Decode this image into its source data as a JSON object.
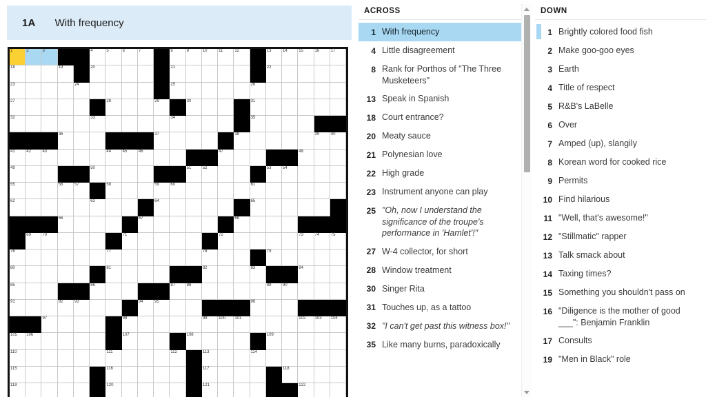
{
  "clue_bar": {
    "number": "1A",
    "text": "With frequency"
  },
  "grid": {
    "size": 21,
    "cursor_cell": {
      "row": 1,
      "col": 1
    },
    "highlight_color": "#a9d9f2",
    "cursor_color": "#fbd033",
    "block_color": "#000000",
    "rows": [
      {
        "blocks": [
          4,
          5,
          10,
          16
        ],
        "nums": {
          "1": "1",
          "2": "2",
          "3": "3",
          "6": "4",
          "7": "5",
          "8": "6",
          "9": "7",
          "11": "8",
          "12": "9",
          "13": "10",
          "14": "11",
          "15": "12",
          "17": "13",
          "18": "14",
          "19": "15",
          "20": "16",
          "21": "17"
        }
      },
      {
        "blocks": [
          5,
          10,
          16
        ],
        "nums": {
          "1": "18",
          "4": "19",
          "6": "20",
          "11": "21",
          "17": "22"
        }
      },
      {
        "blocks": [
          10
        ],
        "nums": {
          "1": "23",
          "5": "24",
          "11": "25",
          "16": "26"
        }
      },
      {
        "blocks": [
          6,
          11,
          15
        ],
        "nums": {
          "1": "27",
          "7": "28",
          "10": "29",
          "12": "30",
          "16": "31"
        }
      },
      {
        "blocks": [
          15,
          20,
          21
        ],
        "nums": {
          "1": "32",
          "6": "33",
          "11": "34",
          "16": "35"
        }
      },
      {
        "blocks": [
          1,
          2,
          3,
          7,
          8,
          9,
          14
        ],
        "nums": {
          "4": "36",
          "10": "37",
          "15": "38",
          "20": "39",
          "21": "40"
        }
      },
      {
        "blocks": [
          12,
          13,
          17,
          18
        ],
        "nums": {
          "1": "41",
          "2": "42",
          "3": "43",
          "7": "44",
          "8": "45",
          "9": "46",
          "14": "47",
          "19": "48"
        }
      },
      {
        "blocks": [
          4,
          5,
          10,
          11,
          16
        ],
        "nums": {
          "1": "49",
          "6": "50",
          "12": "51",
          "13": "52",
          "17": "53",
          "18": "54"
        }
      },
      {
        "blocks": [
          6
        ],
        "nums": {
          "1": "55",
          "4": "56",
          "5": "57",
          "7": "58",
          "10": "59",
          "11": "60",
          "16": "61"
        }
      },
      {
        "blocks": [
          9,
          15,
          21
        ],
        "nums": {
          "1": "62",
          "6": "63",
          "10": "64",
          "16": "65"
        }
      },
      {
        "blocks": [
          1,
          2,
          3,
          8,
          14,
          19,
          20,
          21
        ],
        "nums": {
          "4": "66",
          "9": "67",
          "15": "68"
        }
      },
      {
        "blocks": [
          1,
          7,
          13
        ],
        "nums": {
          "2": "69",
          "3": "70",
          "8": "71",
          "14": "72",
          "19": "73",
          "20": "74",
          "21": "75"
        }
      },
      {
        "blocks": [
          16
        ],
        "nums": {
          "1": "76",
          "7": "77",
          "13": "78",
          "17": "79"
        }
      },
      {
        "blocks": [
          6,
          11,
          12,
          17,
          18
        ],
        "nums": {
          "1": "80",
          "7": "81",
          "13": "82",
          "16": "83",
          "19": "84"
        }
      },
      {
        "blocks": [
          4,
          5,
          9,
          10
        ],
        "nums": {
          "1": "85",
          "6": "86",
          "11": "87",
          "12": "88",
          "17": "89",
          "18": "90"
        }
      },
      {
        "blocks": [
          8,
          13,
          14,
          15,
          19,
          20,
          21
        ],
        "nums": {
          "1": "91",
          "4": "92",
          "5": "93",
          "9": "94",
          "10": "95",
          "16": "96"
        }
      },
      {
        "blocks": [
          1,
          2,
          7
        ],
        "nums": {
          "3": "97",
          "8": "98",
          "13": "99",
          "14": "100",
          "15": "101",
          "19": "102",
          "20": "103",
          "21": "104"
        }
      },
      {
        "blocks": [
          7,
          11,
          16
        ],
        "nums": {
          "1": "105",
          "2": "106",
          "8": "107",
          "12": "108",
          "17": "109"
        }
      },
      {
        "blocks": [
          12
        ],
        "nums": {
          "1": "110",
          "7": "111",
          "11": "112",
          "13": "113",
          "16": "114"
        }
      },
      {
        "blocks": [
          6,
          12,
          17
        ],
        "nums": {
          "1": "115",
          "7": "116",
          "13": "117",
          "18": "118"
        }
      },
      {
        "blocks": [
          6,
          12,
          17,
          18
        ],
        "nums": {
          "1": "119",
          "7": "120",
          "13": "121",
          "19": "122"
        }
      }
    ]
  },
  "across": {
    "heading": "ACROSS",
    "selected_index": 0,
    "clues": [
      {
        "num": "1",
        "text": "With frequency",
        "italic": false
      },
      {
        "num": "4",
        "text": "Little disagreement",
        "italic": false
      },
      {
        "num": "8",
        "text": "Rank for Porthos of \"The Three Musketeers\"",
        "italic": false
      },
      {
        "num": "13",
        "text": "Speak in Spanish",
        "italic": false
      },
      {
        "num": "18",
        "text": "Court entrance?",
        "italic": false
      },
      {
        "num": "20",
        "text": "Meaty sauce",
        "italic": false
      },
      {
        "num": "21",
        "text": "Polynesian love",
        "italic": false
      },
      {
        "num": "22",
        "text": "High grade",
        "italic": false
      },
      {
        "num": "23",
        "text": "Instrument anyone can play",
        "italic": false
      },
      {
        "num": "25",
        "text": "\"Oh, now I understand the significance of the troupe's performance in 'Hamlet'!\"",
        "italic": true
      },
      {
        "num": "27",
        "text": "W-4 collector, for short",
        "italic": false
      },
      {
        "num": "28",
        "text": "Window treatment",
        "italic": false
      },
      {
        "num": "30",
        "text": "Singer Rita",
        "italic": false
      },
      {
        "num": "31",
        "text": "Touches up, as a tattoo",
        "italic": false
      },
      {
        "num": "32",
        "text": "\"I can't get past this witness box!\"",
        "italic": true
      },
      {
        "num": "35",
        "text": "Like many burns, paradoxically",
        "italic": false
      }
    ]
  },
  "down": {
    "heading": "DOWN",
    "marked_index": 0,
    "clues": [
      {
        "num": "1",
        "text": "Brightly colored food fish",
        "italic": false
      },
      {
        "num": "2",
        "text": "Make goo-goo eyes",
        "italic": false
      },
      {
        "num": "3",
        "text": "Earth",
        "italic": false
      },
      {
        "num": "4",
        "text": "Title of respect",
        "italic": false
      },
      {
        "num": "5",
        "text": "R&B's LaBelle",
        "italic": false
      },
      {
        "num": "6",
        "text": "Over",
        "italic": false
      },
      {
        "num": "7",
        "text": "Amped (up), slangily",
        "italic": false
      },
      {
        "num": "8",
        "text": "Korean word for cooked rice",
        "italic": false
      },
      {
        "num": "9",
        "text": "Permits",
        "italic": false
      },
      {
        "num": "10",
        "text": "Find hilarious",
        "italic": false
      },
      {
        "num": "11",
        "text": "\"Well, that's awesome!\"",
        "italic": false
      },
      {
        "num": "12",
        "text": "\"Stillmatic\" rapper",
        "italic": false
      },
      {
        "num": "13",
        "text": "Talk smack about",
        "italic": false
      },
      {
        "num": "14",
        "text": "Taxing times?",
        "italic": false
      },
      {
        "num": "15",
        "text": "Something you shouldn't pass on",
        "italic": false
      },
      {
        "num": "16",
        "text": "\"Diligence is the mother of good ___\": Benjamin Franklin",
        "italic": false
      },
      {
        "num": "17",
        "text": "Consults",
        "italic": false
      },
      {
        "num": "19",
        "text": "\"Men in Black\" role",
        "italic": false
      }
    ]
  },
  "scrollbar": {
    "up_icon": "triangle-up-icon",
    "down_icon": "triangle-down-icon"
  }
}
